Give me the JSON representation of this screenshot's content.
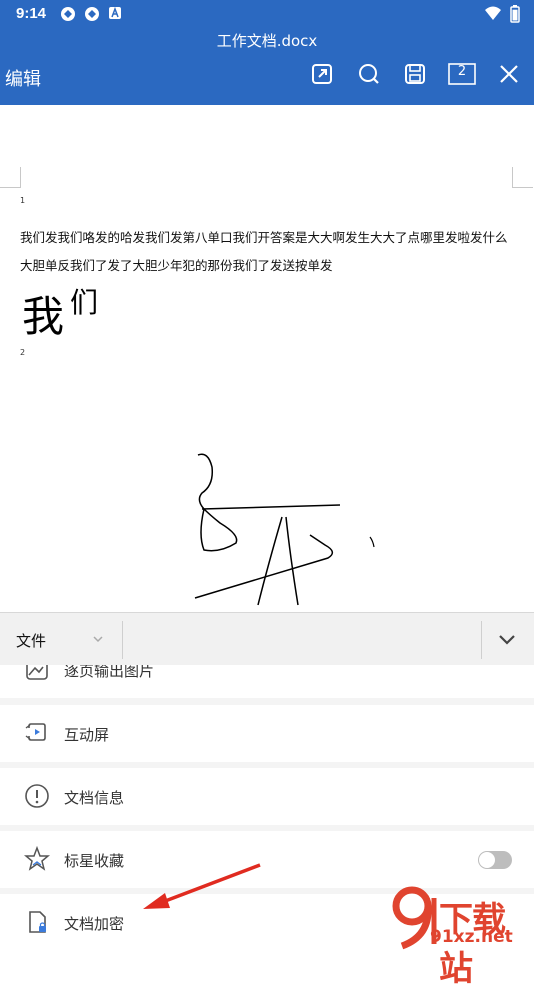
{
  "status_bar": {
    "time": "9:14",
    "battery_level": 0.9
  },
  "title_bar": {
    "doc_title": "工作文档.docx",
    "edit_label": "编辑",
    "page_count": "2"
  },
  "document": {
    "page1_number": "1",
    "line1": "我们发我们咯发的哈发我们发第八单口我们开答案是大大啊发生大大了点哪里发啦发什么",
    "line2": "大胆单反我们了发了大胆少年犯的那份我们了发送按单发",
    "big_char": "我",
    "small_char": "们",
    "page2_number": "2"
  },
  "menu": {
    "header_label": "文件",
    "items": [
      {
        "label": "逐页输出图片",
        "icon": "image-export-icon"
      },
      {
        "label": "互动屏",
        "icon": "screen-cast-icon"
      },
      {
        "label": "文档信息",
        "icon": "info-icon"
      },
      {
        "label": "标星收藏",
        "icon": "star-icon",
        "toggle_on": false
      },
      {
        "label": "文档加密",
        "icon": "lock-document-icon"
      }
    ]
  },
  "watermark": {
    "logo_text": "下载站",
    "url": "91xz.net"
  },
  "colors": {
    "brand_blue": "#2b69c1",
    "arrow_red": "#e02b20",
    "watermark_red": "#e0442f"
  }
}
